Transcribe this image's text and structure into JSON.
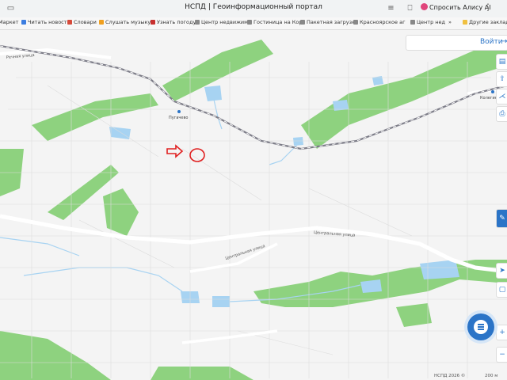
{
  "browser": {
    "tab_title": "НСПД | Геоинформационный портал",
    "alice_label": "Спросить Алису AI",
    "bookmarks": [
      "Маркет",
      "Читать новости",
      "Словари",
      "Слушать музыку",
      "Узнать погоду",
      "Центр недвижим",
      "Гостиница на Корс",
      "Пакетная загрузк",
      "Красноярское аг",
      "Центр нед",
      "Другие закладки"
    ],
    "bookmark_colors": [
      "#f5b400",
      "#3b7de0",
      "#d64a3a",
      "#f0a020",
      "#c8302e",
      "#888888",
      "#888888",
      "#888888",
      "#888888",
      "#888888",
      "#f0c040"
    ]
  },
  "map": {
    "login_label": "Войти",
    "places": [
      "Пугачево",
      "Колегино"
    ],
    "roads": [
      "Речная улица",
      "Центральная улица",
      "Центральная улица"
    ],
    "colors": {
      "forest": "#8ed27f",
      "water": "#a7d3f2",
      "road": "#ffffff",
      "railway": "#7d7d88",
      "land": "#f4f4f4",
      "accent": "#2b74c7",
      "marker": "#e02020"
    },
    "tools": [
      "layers-icon",
      "share-icon",
      "print-icon",
      "measure-icon",
      "locate-icon",
      "info-icon",
      "zoom-in-icon",
      "zoom-out-icon"
    ]
  },
  "footer": {
    "copyright": "НСПД 2026 ©",
    "scale": "200 м"
  }
}
